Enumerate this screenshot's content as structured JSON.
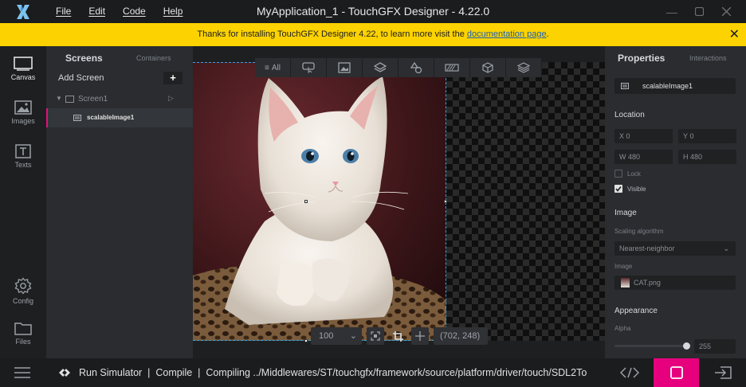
{
  "title_bar": {
    "title": "MyApplication_1 - TouchGFX Designer - 4.22.0",
    "menu": [
      {
        "label": "File"
      },
      {
        "label": "Edit"
      },
      {
        "label": "Code"
      },
      {
        "label": "Help"
      }
    ]
  },
  "banner": {
    "text_before": "Thanks for installing TouchGFX Designer 4.22, to learn more visit the ",
    "link": "documentation page",
    "text_after": "."
  },
  "left_nav": {
    "items": [
      {
        "label": "Canvas",
        "icon": "canvas-icon",
        "active": true
      },
      {
        "label": "Images",
        "icon": "images-icon",
        "active": false
      },
      {
        "label": "Texts",
        "icon": "texts-icon",
        "active": false
      },
      {
        "label": "Config",
        "icon": "gear-icon",
        "active": false
      },
      {
        "label": "Files",
        "icon": "folder-icon",
        "active": false
      }
    ]
  },
  "screens_panel": {
    "tabs": [
      {
        "label": "Screens"
      },
      {
        "label": "Containers"
      }
    ],
    "add_screen_label": "Add Screen",
    "tree": [
      {
        "label": "Screen1",
        "level": 0
      },
      {
        "label": "scalableImage1",
        "level": 1,
        "selected": true
      }
    ]
  },
  "canvas": {
    "toolbar": [
      {
        "label": "All",
        "icon": "list-icon"
      },
      {
        "label": "",
        "icon": "button-widget-icon"
      },
      {
        "label": "",
        "icon": "image-widget-icon"
      },
      {
        "label": "",
        "icon": "layers-icon"
      },
      {
        "label": "",
        "icon": "shapes-icon"
      },
      {
        "label": "",
        "icon": "progress-icon"
      },
      {
        "label": "",
        "icon": "cube-icon"
      },
      {
        "label": "",
        "icon": "stack-icon"
      }
    ],
    "zoom": "100",
    "cursor_coords": "(702, 248)"
  },
  "properties_panel": {
    "tabs": [
      {
        "label": "Properties"
      },
      {
        "label": "Interactions"
      }
    ],
    "widget_name": "scalableImage1",
    "location": {
      "title": "Location",
      "x_label": "X",
      "x": "0",
      "y_label": "Y",
      "y": "0",
      "w_label": "W",
      "w": "480",
      "h_label": "H",
      "h": "480",
      "lock_label": "Lock",
      "lock": false,
      "visible_label": "Visible",
      "visible": true
    },
    "image": {
      "title": "Image",
      "scaling_label": "Scaling algorithm",
      "scaling_value": "Nearest-neighbor",
      "image_label": "Image",
      "image_value": "CAT.png"
    },
    "appearance": {
      "title": "Appearance",
      "alpha_label": "Alpha",
      "alpha": 255
    }
  },
  "status_bar": {
    "text": "Run Simulator  |  Compile  |  Compiling ../Middlewares/ST/touchgfx/framework/source/platform/driver/touch/SDL2To"
  },
  "colors": {
    "accent": "#e6007e",
    "banner": "#fcd200",
    "selection": "#37a3e0"
  }
}
